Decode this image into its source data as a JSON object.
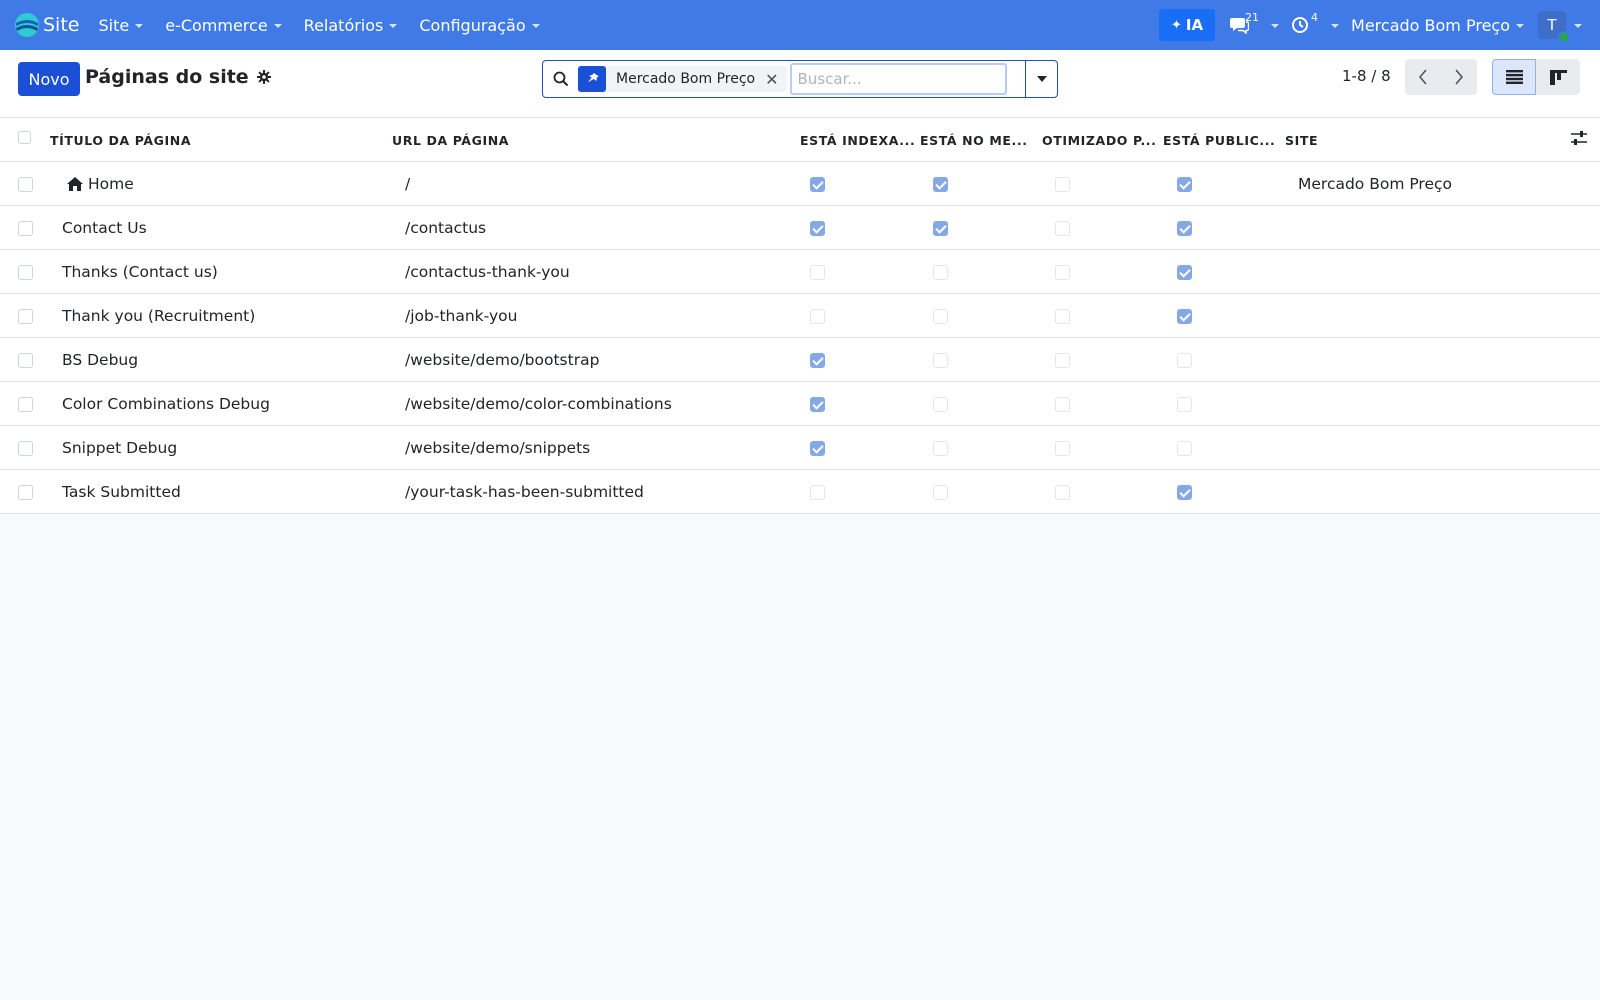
{
  "navbar": {
    "app_name": "Site",
    "menu": [
      {
        "label": "Site"
      },
      {
        "label": "e-Commerce"
      },
      {
        "label": "Relatórios"
      },
      {
        "label": "Configuração"
      }
    ],
    "ai_label": "IA",
    "messages_count": "21",
    "activities_count": "4",
    "company": "Mercado Bom Preço",
    "avatar_initial": "T",
    "accent_color": "#3f7ae6"
  },
  "control": {
    "new_label": "Novo",
    "title": "Páginas do site",
    "search": {
      "facet_label": "Mercado Bom Preço",
      "placeholder": "Buscar..."
    },
    "pager": "1-8 / 8"
  },
  "table": {
    "columns": [
      {
        "label": "TÍTULO DA PÁGINA"
      },
      {
        "label": "URL DA PÁGINA"
      },
      {
        "label": "ESTÁ INDEXA..."
      },
      {
        "label": "ESTÁ NO ME..."
      },
      {
        "label": "OTIMIZADO P..."
      },
      {
        "label": "ESTÁ PUBLIC..."
      },
      {
        "label": "SITE"
      }
    ],
    "rows": [
      {
        "title": "Home",
        "url": "/",
        "indexed": true,
        "in_menu": true,
        "optimized": false,
        "published": true,
        "site": "Mercado Bom Preço",
        "icon": "home-icon"
      },
      {
        "title": "Contact Us",
        "url": "/contactus",
        "indexed": true,
        "in_menu": true,
        "optimized": false,
        "published": true,
        "site": ""
      },
      {
        "title": "Thanks (Contact us)",
        "url": "/contactus-thank-you",
        "indexed": false,
        "in_menu": false,
        "optimized": false,
        "published": true,
        "site": ""
      },
      {
        "title": "Thank you (Recruitment)",
        "url": "/job-thank-you",
        "indexed": false,
        "in_menu": false,
        "optimized": false,
        "published": true,
        "site": ""
      },
      {
        "title": "BS Debug",
        "url": "/website/demo/bootstrap",
        "indexed": true,
        "in_menu": false,
        "optimized": false,
        "published": false,
        "site": ""
      },
      {
        "title": "Color Combinations Debug",
        "url": "/website/demo/color-combinations",
        "indexed": true,
        "in_menu": false,
        "optimized": false,
        "published": false,
        "site": ""
      },
      {
        "title": "Snippet Debug",
        "url": "/website/demo/snippets",
        "indexed": true,
        "in_menu": false,
        "optimized": false,
        "published": false,
        "site": ""
      },
      {
        "title": "Task Submitted",
        "url": "/your-task-has-been-submitted",
        "indexed": false,
        "in_menu": false,
        "optimized": false,
        "published": true,
        "site": ""
      }
    ]
  }
}
